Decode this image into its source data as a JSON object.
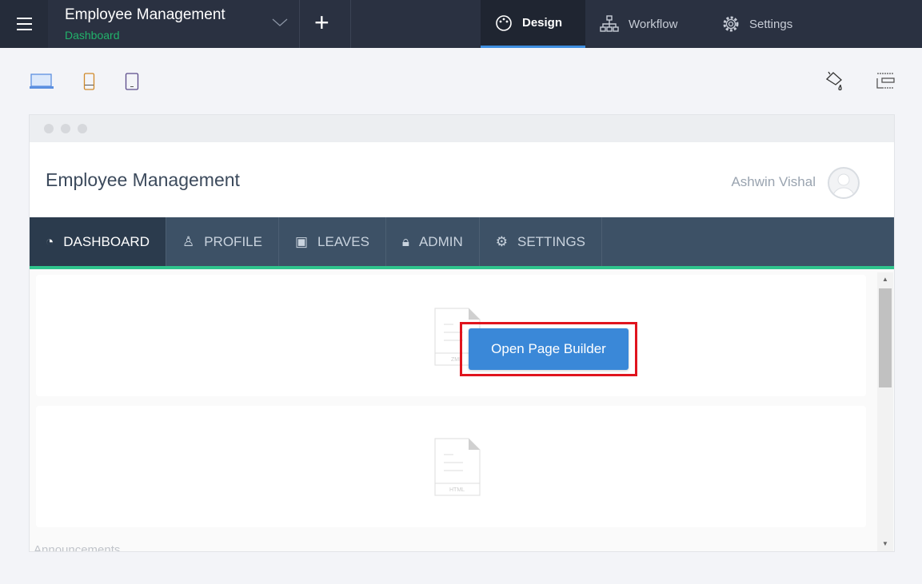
{
  "topbar": {
    "app_title": "Employee Management",
    "app_subtitle": "Dashboard",
    "tabs": [
      {
        "label": "Design",
        "active": true
      },
      {
        "label": "Workflow"
      },
      {
        "label": "Settings"
      }
    ]
  },
  "preview": {
    "app_title": "Employee Management",
    "user_name": "Ashwin Vishal",
    "nav": [
      {
        "label": "DASHBOARD",
        "active": true
      },
      {
        "label": "PROFILE"
      },
      {
        "label": "LEAVES"
      },
      {
        "label": "ADMIN"
      },
      {
        "label": "SETTINGS"
      }
    ],
    "doc1_label": "ZML",
    "doc2_label": "HTML",
    "open_button": "Open Page Builder",
    "section_label": "Announcements"
  },
  "colors": {
    "accent": "#3a88d8",
    "green": "#2fc48d",
    "highlight": "#e0141e"
  }
}
